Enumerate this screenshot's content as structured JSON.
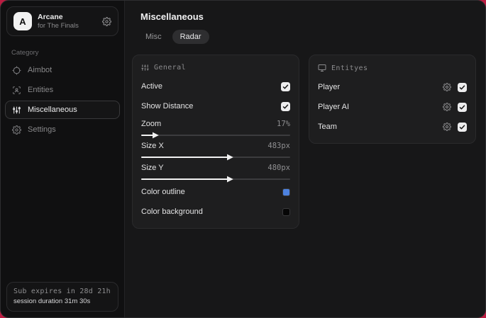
{
  "window": {
    "accent_bg": "#bb1c41"
  },
  "sidebar": {
    "account": {
      "initial": "A",
      "name": "Arcane",
      "subtitle": "for The Finals"
    },
    "category_label": "Category",
    "items": [
      {
        "label": "Aimbot",
        "icon": "crosshair-icon",
        "selected": false
      },
      {
        "label": "Entities",
        "icon": "scan-person-icon",
        "selected": false
      },
      {
        "label": "Miscellaneous",
        "icon": "sliders-icon",
        "selected": true
      },
      {
        "label": "Settings",
        "icon": "gear-icon",
        "selected": false
      }
    ],
    "footer": {
      "line1": "Sub expires in 28d 21h",
      "line2": "session duration 31m 30s"
    }
  },
  "main": {
    "title": "Miscellaneous",
    "tabs": [
      {
        "label": "Misc",
        "active": false
      },
      {
        "label": "Radar",
        "active": true
      }
    ]
  },
  "panels": {
    "general": {
      "title": "General",
      "toggles": [
        {
          "label": "Active",
          "checked": true
        },
        {
          "label": "Show Distance",
          "checked": true
        }
      ],
      "sliders": [
        {
          "label": "Zoom",
          "value": "17%",
          "fill_pct": "8%"
        },
        {
          "label": "Size X",
          "value": "483px",
          "fill_pct": "58%"
        },
        {
          "label": "Size Y",
          "value": "480px",
          "fill_pct": "58%"
        }
      ],
      "colors": [
        {
          "label": "Color outline",
          "swatch": "#4d82df"
        },
        {
          "label": "Color background",
          "swatch": "#060606"
        }
      ]
    },
    "entities": {
      "title": "Entityes",
      "rows": [
        {
          "label": "Player",
          "checked": true
        },
        {
          "label": "Player AI",
          "checked": true
        },
        {
          "label": "Team",
          "checked": true
        }
      ]
    }
  }
}
